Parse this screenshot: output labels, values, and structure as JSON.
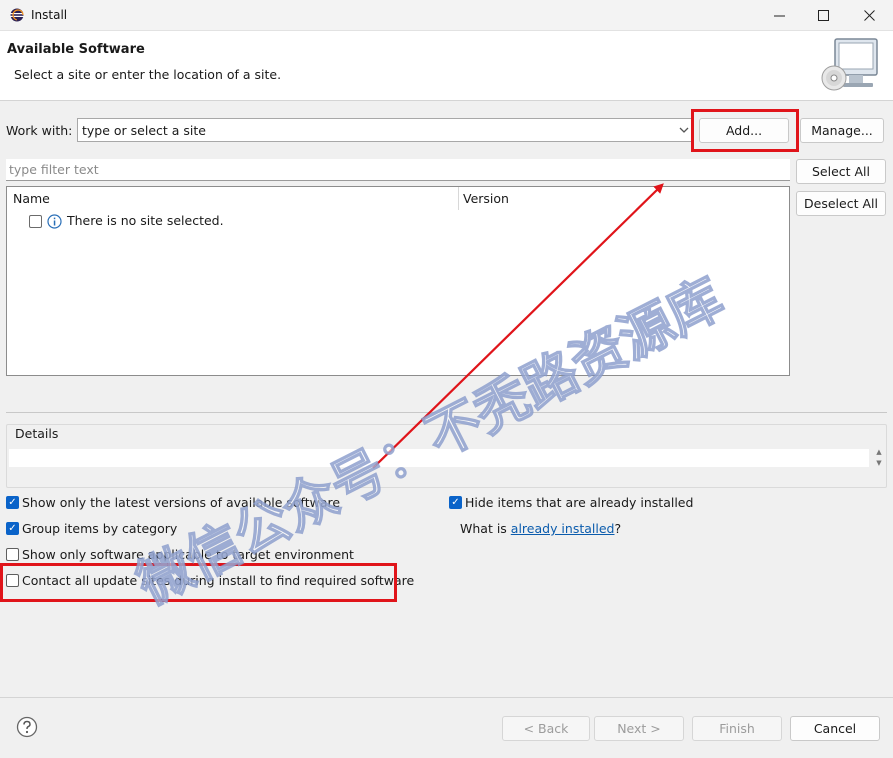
{
  "window": {
    "title": "Install",
    "minimize_glyph": "—",
    "maximize_glyph": "☐",
    "close_glyph": "✕"
  },
  "header": {
    "title": "Available Software",
    "subtitle": "Select a site or enter the location of a site."
  },
  "work_with": {
    "label": "Work with:",
    "value": "type or select a site",
    "add_button": "Add...",
    "manage_button": "Manage..."
  },
  "filter": {
    "placeholder": "type filter text"
  },
  "selection": {
    "select_all": "Select All",
    "deselect_all": "Deselect All"
  },
  "table": {
    "columns": [
      "Name",
      "Version"
    ],
    "rows": [
      {
        "name": "There is no site selected.",
        "version": "",
        "checked": false
      }
    ]
  },
  "details": {
    "label": "Details"
  },
  "options": {
    "show_latest": {
      "label": "Show only the latest versions of available software",
      "checked": true
    },
    "group_by_category": {
      "label": "Group items by category",
      "checked": true
    },
    "show_applicable": {
      "label": "Show only software applicable to target environment",
      "checked": false
    },
    "contact_all": {
      "label": "Contact all update sites during install to find required software",
      "checked": false
    },
    "hide_installed": {
      "label": "Hide items that are already installed",
      "checked": true
    },
    "what_is_prefix": "What is ",
    "already_installed_link": "already installed",
    "what_is_suffix": "?"
  },
  "footer": {
    "back": "< Back",
    "next": "Next >",
    "finish": "Finish",
    "cancel": "Cancel"
  },
  "watermark": {
    "text": "微信公众号：不秃路资源库"
  },
  "colors": {
    "annotation_red": "#e0141a",
    "checkbox_blue": "#0a63c9",
    "link_blue": "#0b5cad"
  }
}
